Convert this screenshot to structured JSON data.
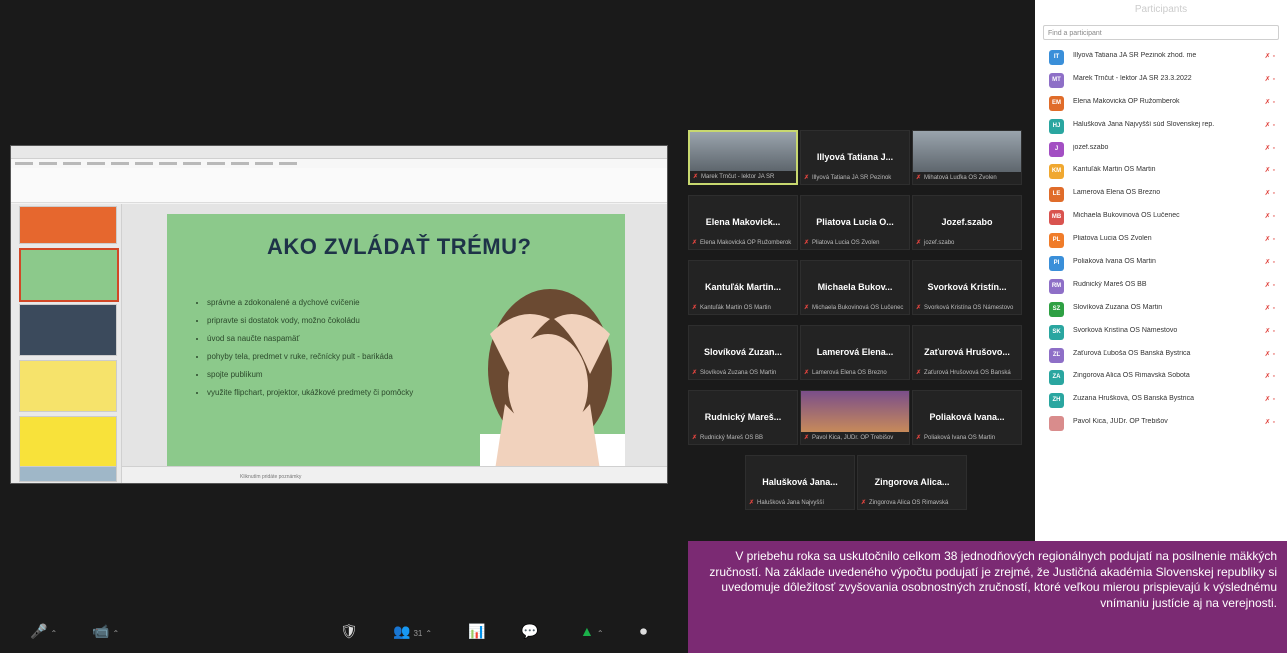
{
  "presentation": {
    "slide_title": "AKO ZVLÁDAŤ TRÉMU?",
    "bullets": [
      "správne a zdokonalené a dychové cvičenie",
      "pripravte si dostatok vody, možno čokoládu",
      "úvod sa naučte naspamäť",
      "pohyby tela, predmet v ruke, rečnícky pult - barikáda",
      "spojte publikum",
      "využite flipchart, projektor, ukážkové predmety či pomôcky"
    ],
    "notes_placeholder": "Kliknutím pridáte poznámky"
  },
  "gallery": [
    {
      "name": "",
      "sub": "Marek Trnčut - lektor JA SR",
      "type": "video",
      "active": true
    },
    {
      "name": "Illyová Tatiana J...",
      "sub": "Illyová Tatiana JA SR Pezinok",
      "type": "name"
    },
    {
      "name": "",
      "sub": "Mihatová Luďka OS Zvolen",
      "type": "video"
    },
    {
      "name": "Elena Makovick...",
      "sub": "Elena Makovická OP Ružomberok",
      "type": "name"
    },
    {
      "name": "Pliatova Lucia O...",
      "sub": "Pliatova Lucia OS Zvolen",
      "type": "name"
    },
    {
      "name": "Jozef.szabo",
      "sub": "jozef.szabo",
      "type": "name"
    },
    {
      "name": "Kantuľák Martin...",
      "sub": "Kantuľák Martin OS Martin",
      "type": "name"
    },
    {
      "name": "Michaela Bukov...",
      "sub": "Michaela Bukovinová OS Lučenec",
      "type": "name"
    },
    {
      "name": "Svorková Kristín...",
      "sub": "Svorková Kristína OS Námestovo",
      "type": "name"
    },
    {
      "name": "Slovíková Zuzan...",
      "sub": "Slovíková Zuzana OS Martin",
      "type": "name"
    },
    {
      "name": "Lamerová Elena...",
      "sub": "Lamerová Elena OS Brezno",
      "type": "name"
    },
    {
      "name": "Zaťurová Hrušovo...",
      "sub": "Zaťurová Hrušovová OS Banská",
      "type": "name"
    },
    {
      "name": "Rudnický Mareš...",
      "sub": "Rudnický Mareš OS BB",
      "type": "name"
    },
    {
      "name": "",
      "sub": "Pavol Kica, JUDr. OP Trebišov",
      "type": "video"
    },
    {
      "name": "Poliaková Ivana...",
      "sub": "Poliaková Ivana OS Martin",
      "type": "name"
    },
    {
      "name": "Halušková Jana...",
      "sub": "Halušková Jana Najvyšší",
      "type": "name"
    },
    {
      "name": "Zingorova Alica...",
      "sub": "Zingorova Alica OS Rimavská",
      "type": "name"
    }
  ],
  "toolbar": {
    "mute": "🎤",
    "video": "📹",
    "security": "🛡",
    "participants": "👥",
    "participants_count": "31",
    "polls": "📊",
    "chat": "💬",
    "share": "▲",
    "record": "⏺"
  },
  "panel": {
    "header": "Participants",
    "search_placeholder": "Find a participant",
    "participants": [
      {
        "initials": "IT",
        "color": "#3a8fd9",
        "name": "Illyová Tatiana JA SR Pezinok zhod. me"
      },
      {
        "initials": "MT",
        "color": "#8e6fc7",
        "name": "Marek Trnčut - lektor JA SR 23.3.2022"
      },
      {
        "initials": "EM",
        "color": "#e06c2a",
        "name": "Elena Makovická OP Ružomberok"
      },
      {
        "initials": "HJ",
        "color": "#2aa6a0",
        "name": "Halušková Jana Najvyšší súd Slovenskej rep."
      },
      {
        "initials": "J",
        "color": "#a34fc3",
        "name": "jozef.szabo"
      },
      {
        "initials": "KM",
        "color": "#f0a830",
        "name": "Kantuľák Martin OS Martin"
      },
      {
        "initials": "LE",
        "color": "#e06c2a",
        "name": "Lamerová Elena OS Brezno"
      },
      {
        "initials": "MB",
        "color": "#d9534f",
        "name": "Michaela Bukovinová OS Lučenec"
      },
      {
        "initials": "PL",
        "color": "#f07c2a",
        "name": "Pliatova Lucia OS Zvolen"
      },
      {
        "initials": "PI",
        "color": "#3a8fd9",
        "name": "Poliaková Ivana OS Martin"
      },
      {
        "initials": "RM",
        "color": "#8e6fc7",
        "name": "Rudnický Mareš OS BB"
      },
      {
        "initials": "SZ",
        "color": "#2ea043",
        "name": "Slovíková Zuzana OS Martin"
      },
      {
        "initials": "SK",
        "color": "#2aa6a0",
        "name": "Svorková Kristína OS Námestovo"
      },
      {
        "initials": "ZĽ",
        "color": "#8e6fc7",
        "name": "Zaťurová Ľuboša OS Banská Bystrica"
      },
      {
        "initials": "ZA",
        "color": "#2aa6a0",
        "name": "Zingorova Alica OS Rimavská Sobota"
      },
      {
        "initials": "ZH",
        "color": "#2aa6a0",
        "name": "Zuzana Hrušková, OS Banská Bystrica"
      },
      {
        "initials": "",
        "color": "#d98c8c",
        "name": "Pavol Kica, JUDr. OP Trebišov"
      }
    ]
  },
  "caption": "V priebehu roka sa uskutočnilo celkom 38 jednodňových regionálnych podujatí na posilnenie mäkkých zručností. Na základe uvedeného výpočtu podujatí je zrejmé, že Justičná akadémia Slovenskej republiky si uvedomuje dôležitosť zvyšovania osobnostných zručností, ktoré veľkou mierou prispievajú k výslednému vnímaniu justície aj na verejnosti."
}
